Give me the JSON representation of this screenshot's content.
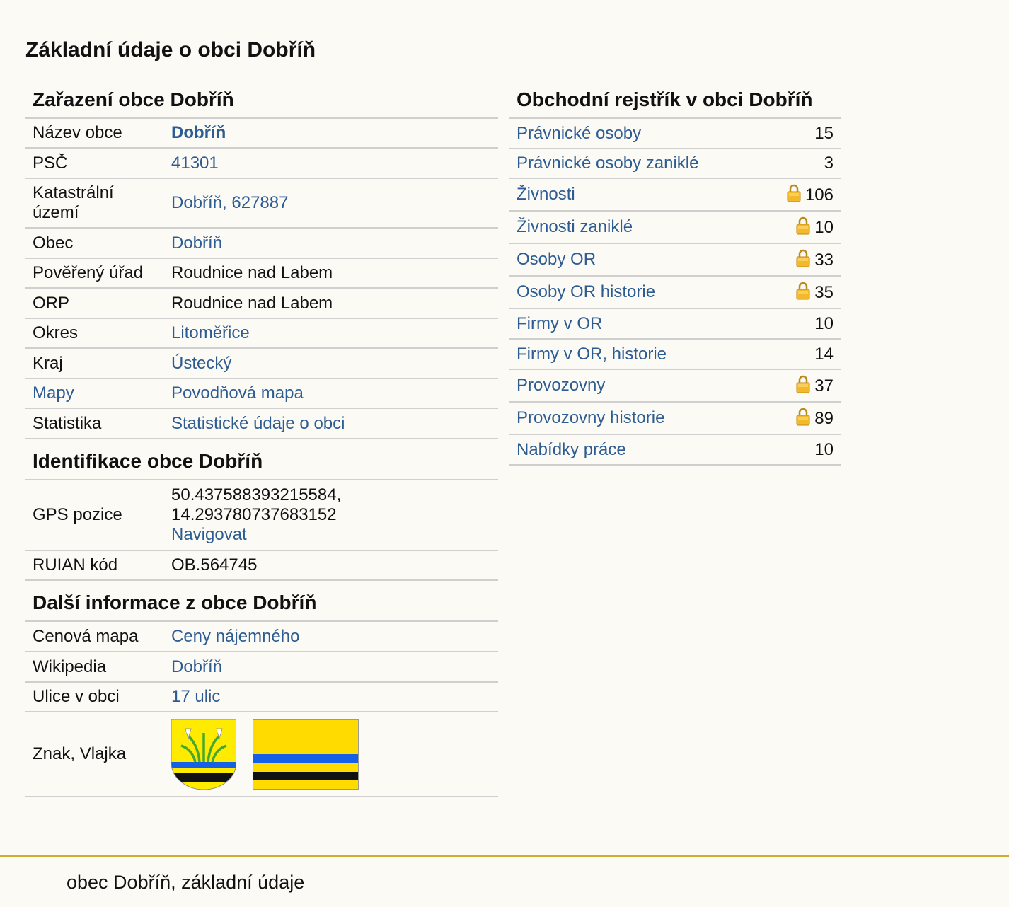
{
  "page": {
    "title": "Základní údaje o obci Dobříň",
    "footer": "obec Dobříň, základní údaje"
  },
  "zarazeni": {
    "heading": "Zařazení obce Dobříň",
    "rows": [
      {
        "label": "Název obce",
        "value": "Dobříň"
      },
      {
        "label": "PSČ",
        "value": "41301"
      },
      {
        "label": "Katastrální území",
        "value": "Dobříň, 627887"
      },
      {
        "label": "Obec",
        "value": "Dobříň"
      },
      {
        "label": "Pověřený úřad",
        "value": "Roudnice nad Labem"
      },
      {
        "label": "ORP",
        "value": "Roudnice nad Labem"
      },
      {
        "label": "Okres",
        "value": "Litoměřice"
      },
      {
        "label": "Kraj",
        "value": "Ústecký"
      },
      {
        "label": "Mapy",
        "value": "Povodňová mapa"
      },
      {
        "label": "Statistika",
        "value": "Statistické údaje o obci"
      }
    ]
  },
  "identifikace": {
    "heading": "Identifikace obce Dobříň",
    "gps_label": "GPS pozice",
    "gps_lat": "50.437588393215584,",
    "gps_lon": "14.293780737683152",
    "gps_link": "Navigovat",
    "ruian_label": "RUIAN kód",
    "ruian_value": "OB.564745"
  },
  "dalsi": {
    "heading": "Další informace z obce Dobříň",
    "rows": [
      {
        "label": "Cenová mapa",
        "value": "Ceny nájemného"
      },
      {
        "label": "Wikipedia",
        "value": "Dobříň"
      },
      {
        "label": "Ulice v obci",
        "value": "17 ulic"
      }
    ],
    "emblem_label": "Znak, Vlajka"
  },
  "rejstrik": {
    "heading": "Obchodní rejstřík v obci Dobříň",
    "rows": [
      {
        "label": "Právnické osoby",
        "count": "15",
        "locked": false
      },
      {
        "label": "Právnické osoby zaniklé",
        "count": "3",
        "locked": false
      },
      {
        "label": "Živnosti",
        "count": "106",
        "locked": true
      },
      {
        "label": "Živnosti zaniklé",
        "count": "10",
        "locked": true
      },
      {
        "label": "Osoby OR",
        "count": "33",
        "locked": true
      },
      {
        "label": "Osoby OR historie",
        "count": "35",
        "locked": true
      },
      {
        "label": "Firmy v OR",
        "count": "10",
        "locked": false
      },
      {
        "label": "Firmy v OR, historie",
        "count": "14",
        "locked": false
      },
      {
        "label": "Provozovny",
        "count": "37",
        "locked": true
      },
      {
        "label": "Provozovny historie",
        "count": "89",
        "locked": true
      },
      {
        "label": "Nabídky práce",
        "count": "10",
        "locked": false
      }
    ]
  },
  "icons": {
    "lock": "lock-icon",
    "coat_of_arms": "coat-of-arms-icon",
    "flag": "flag-icon"
  },
  "colors": {
    "link": "#2d5c93",
    "footer_accent": "#d4aa2c",
    "emblem_yellow": "#ffdb00",
    "emblem_blue": "#1560e6"
  }
}
